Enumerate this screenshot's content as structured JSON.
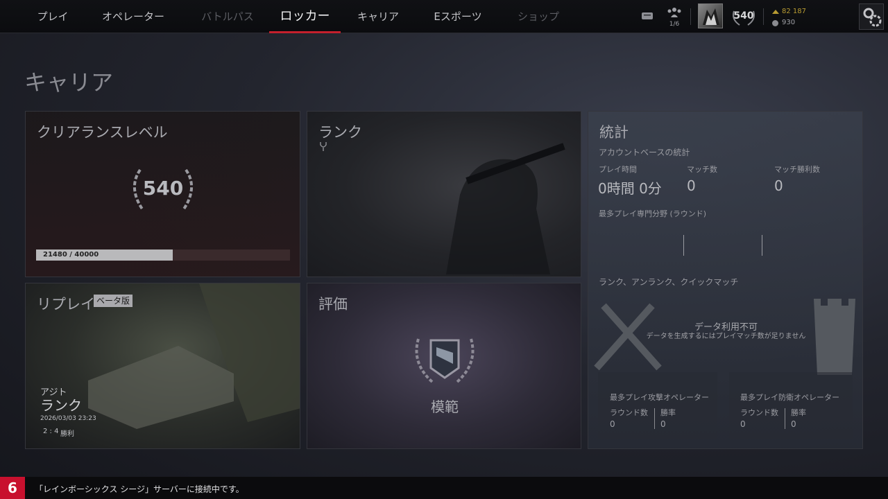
{
  "nav": {
    "items": [
      {
        "label": "プレイ",
        "state": "normal"
      },
      {
        "label": "オペレーター",
        "state": "normal"
      },
      {
        "label": "バトルパス",
        "state": "dim"
      },
      {
        "label": "ロッカー",
        "state": "active"
      },
      {
        "label": "キャリア",
        "state": "normal"
      },
      {
        "label": "Eスポーツ",
        "state": "normal"
      },
      {
        "label": "ショップ",
        "state": "dim"
      }
    ],
    "accent": "#c4202c"
  },
  "hud": {
    "squad_count": "1/6",
    "level": "540",
    "renown": "82 187",
    "credits": "930",
    "icons": [
      "chat-icon",
      "squad-icon",
      "avatar",
      "level-laurel-icon",
      "renown-icon",
      "credits-icon",
      "gear-icon"
    ]
  },
  "page": {
    "title": "キャリア"
  },
  "clearance": {
    "title": "クリアランスレベル",
    "level": "540",
    "xp_text": "21480 / 40000",
    "xp_fraction": 0.537
  },
  "rank": {
    "title": "ランク"
  },
  "replay": {
    "title": "リプレイ",
    "beta_badge": "ベータ版",
    "map": "アジト",
    "mode": "ランク",
    "datetime": "2026/03/03   23:23",
    "score": "2 : 4",
    "result": "勝利"
  },
  "evaluation": {
    "title": "評価",
    "grade": "模範"
  },
  "stats": {
    "title": "統計",
    "subtitle": "アカウントベースの統計",
    "play_time_label": "プレイ時間",
    "play_time_value": "0時間 0分",
    "matches_label": "マッチ数",
    "matches_value": "0",
    "wins_label": "マッチ勝利数",
    "wins_value": "0",
    "specialty_label": "最多プレイ専門分野 (ラウンド)",
    "modes_label": "ランク、アンランク、クイックマッチ",
    "no_data_title": "データ利用不可",
    "no_data_desc": "データを生成するにはプレイマッチ数が足りません",
    "attack_op": {
      "title": "最多プレイ攻撃オペレーター",
      "rounds_label": "ラウンド数",
      "rounds_value": "0",
      "winrate_label": "勝率",
      "winrate_value": "0"
    },
    "defense_op": {
      "title": "最多プレイ防衛オペレーター",
      "rounds_label": "ラウンド数",
      "rounds_value": "0",
      "winrate_label": "勝率",
      "winrate_value": "0"
    }
  },
  "status": {
    "number": "6",
    "message": "「レインボーシックス シージ」サーバーに接続中です。"
  }
}
